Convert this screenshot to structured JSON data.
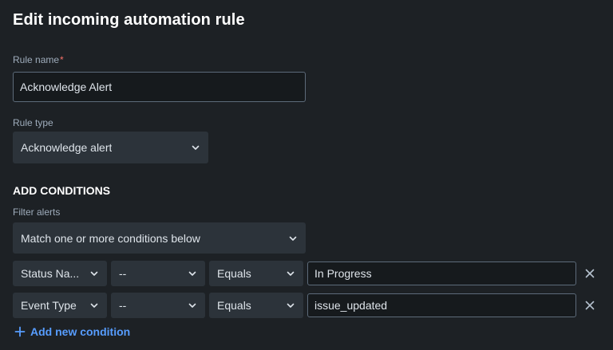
{
  "page": {
    "title": "Edit incoming automation rule"
  },
  "rule_name": {
    "label": "Rule name",
    "required_marker": "*",
    "value": "Acknowledge Alert"
  },
  "rule_type": {
    "label": "Rule type",
    "value": "Acknowledge alert"
  },
  "conditions": {
    "heading": "ADD CONDITIONS",
    "filter_label": "Filter alerts",
    "match_value": "Match one or more conditions below",
    "rows": [
      {
        "field": "Status Na...",
        "operator_prefix": "--",
        "operator": "Equals",
        "value": "In Progress"
      },
      {
        "field": "Event Type",
        "operator_prefix": "--",
        "operator": "Equals",
        "value": "issue_updated"
      }
    ],
    "add_label": "Add new condition"
  },
  "colors": {
    "background": "#1d2125",
    "input_background": "#161a1d",
    "select_background": "#2c333a",
    "accent": "#579dff",
    "required": "#f87168"
  }
}
